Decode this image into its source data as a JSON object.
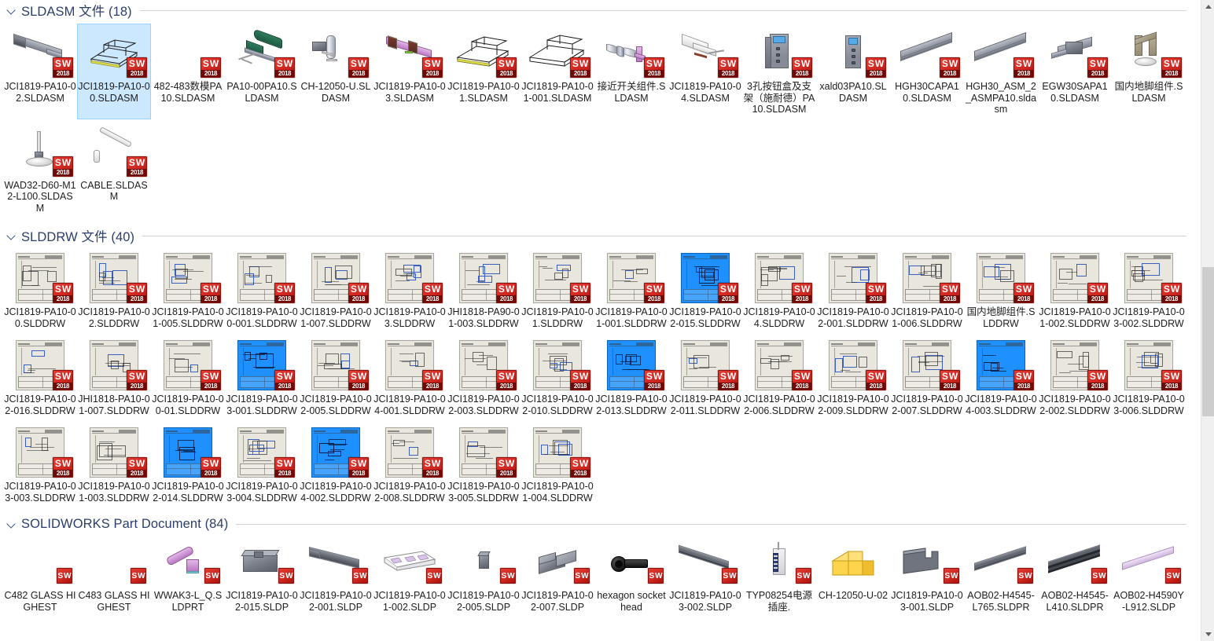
{
  "window": {
    "view_mode": "large-icons",
    "accent_selection": "#cce8ff",
    "group_header_color": "#2b3e6b"
  },
  "scrollbar": {
    "up_arrow": "▲",
    "down_arrow": "▼"
  },
  "groups": [
    {
      "id": "sldasm",
      "title": "SLDASM 文件 (18)",
      "items": [
        {
          "name": "JCI1819-PA10-02.SLDASM",
          "icon": "sw-assembly-conveyor",
          "selected": false
        },
        {
          "name": "JCI1819-PA10-00.SLDASM",
          "icon": "sw-assembly-frame-wire",
          "selected": true
        },
        {
          "name": "482-483数模PA10.SLDASM",
          "icon": "sw-badge-only",
          "selected": false
        },
        {
          "name": "PA10-00PA10.SLDASM",
          "icon": "sw-assembly-green-arm",
          "selected": false
        },
        {
          "name": "CH-12050-U.SLDASM",
          "icon": "sw-assembly-clamp",
          "selected": false
        },
        {
          "name": "JCI1819-PA10-03.SLDASM",
          "icon": "sw-assembly-purple-beam",
          "selected": false
        },
        {
          "name": "JCI1819-PA10-01.SLDASM",
          "icon": "sw-assembly-frame-wire",
          "selected": false
        },
        {
          "name": "JCI1819-PA10-01-001.SLDASM",
          "icon": "sw-assembly-frame-wire",
          "selected": false
        },
        {
          "name": "接近开关组件.SLDASM",
          "icon": "sw-assembly-sensor",
          "selected": false
        },
        {
          "name": "JCI1819-PA10-04.SLDASM",
          "icon": "sw-assembly-white-bracket",
          "selected": false
        },
        {
          "name": "3孔按钮盒及支架（施耐德）PA10.SLDASM",
          "icon": "sw-assembly-buttonbox",
          "selected": false
        },
        {
          "name": "xald03PA10.SLDASM",
          "icon": "sw-assembly-buttonbox-slim",
          "selected": false
        },
        {
          "name": "HGH30CAPA10.SLDASM",
          "icon": "sw-assembly-linear-rail",
          "selected": false
        },
        {
          "name": "HGH30_ASM_2_ASMPA10.sldasm",
          "icon": "sw-assembly-linear-rail",
          "selected": false
        },
        {
          "name": "EGW30SAPA10.SLDASM",
          "icon": "sw-assembly-rail-block",
          "selected": false
        },
        {
          "name": "国内地脚组件.SLDASM",
          "icon": "sw-assembly-footing",
          "selected": false
        },
        {
          "name": "WAD32-D60-M12-L100.SLDASM",
          "icon": "sw-assembly-leveling-foot",
          "selected": false
        },
        {
          "name": "CABLE.SLDASM",
          "icon": "sw-assembly-cable",
          "selected": false
        }
      ]
    },
    {
      "id": "slddrw",
      "title": "SLDDRW 文件 (40)",
      "items": [
        {
          "name": "JCI1819-PA10-00.SLDDRW",
          "icon": "sw-drawing",
          "variant": "beige"
        },
        {
          "name": "JCI1819-PA10-02.SLDDRW",
          "icon": "sw-drawing",
          "variant": "beige"
        },
        {
          "name": "JCI1819-PA10-01-005.SLDDRW",
          "icon": "sw-drawing",
          "variant": "beige"
        },
        {
          "name": "JCI1819-PA10-00-001.SLDDRW",
          "icon": "sw-drawing",
          "variant": "beige"
        },
        {
          "name": "JCI1819-PA10-01-007.SLDDRW",
          "icon": "sw-drawing",
          "variant": "beige"
        },
        {
          "name": "JCI1819-PA10-03.SLDDRW",
          "icon": "sw-drawing",
          "variant": "beige"
        },
        {
          "name": "JHI1818-PA90-01-003.SLDDRW",
          "icon": "sw-drawing",
          "variant": "beige"
        },
        {
          "name": "JCI1819-PA10-01.SLDDRW",
          "icon": "sw-drawing",
          "variant": "beige"
        },
        {
          "name": "JCI1819-PA10-01-001.SLDDRW",
          "icon": "sw-drawing",
          "variant": "beige"
        },
        {
          "name": "JCI1819-PA10-02-015.SLDDRW",
          "icon": "sw-drawing",
          "variant": "blue"
        },
        {
          "name": "JCI1819-PA10-04.SLDDRW",
          "icon": "sw-drawing",
          "variant": "beige"
        },
        {
          "name": "JCI1819-PA10-02-001.SLDDRW",
          "icon": "sw-drawing",
          "variant": "beige"
        },
        {
          "name": "JCI1819-PA10-01-006.SLDDRW",
          "icon": "sw-drawing",
          "variant": "beige"
        },
        {
          "name": "国内地脚组件.SLDDRW",
          "icon": "sw-drawing",
          "variant": "beige"
        },
        {
          "name": "JCI1819-PA10-01-002.SLDDRW",
          "icon": "sw-drawing",
          "variant": "beige"
        },
        {
          "name": "JCI1819-PA10-03-002.SLDDRW",
          "icon": "sw-drawing",
          "variant": "beige"
        },
        {
          "name": "JCI1819-PA10-02-016.SLDDRW",
          "icon": "sw-drawing",
          "variant": "beige"
        },
        {
          "name": "JHI1818-PA10-01-007.SLDDRW",
          "icon": "sw-drawing",
          "variant": "beige"
        },
        {
          "name": "JCI1819-PA10-00-01.SLDDRW",
          "icon": "sw-drawing",
          "variant": "beige"
        },
        {
          "name": "JCI1819-PA10-03-001.SLDDRW",
          "icon": "sw-drawing",
          "variant": "blue"
        },
        {
          "name": "JCI1819-PA10-02-005.SLDDRW",
          "icon": "sw-drawing",
          "variant": "beige"
        },
        {
          "name": "JCI1819-PA10-04-001.SLDDRW",
          "icon": "sw-drawing",
          "variant": "beige"
        },
        {
          "name": "JCI1819-PA10-02-003.SLDDRW",
          "icon": "sw-drawing",
          "variant": "beige"
        },
        {
          "name": "JCI1819-PA10-02-010.SLDDRW",
          "icon": "sw-drawing",
          "variant": "beige"
        },
        {
          "name": "JCI1819-PA10-02-013.SLDDRW",
          "icon": "sw-drawing",
          "variant": "blue"
        },
        {
          "name": "JCI1819-PA10-02-011.SLDDRW",
          "icon": "sw-drawing",
          "variant": "beige"
        },
        {
          "name": "JCI1819-PA10-02-006.SLDDRW",
          "icon": "sw-drawing",
          "variant": "beige"
        },
        {
          "name": "JCI1819-PA10-02-009.SLDDRW",
          "icon": "sw-drawing",
          "variant": "beige"
        },
        {
          "name": "JCI1819-PA10-02-007.SLDDRW",
          "icon": "sw-drawing",
          "variant": "beige"
        },
        {
          "name": "JCI1819-PA10-04-003.SLDDRW",
          "icon": "sw-drawing",
          "variant": "blue"
        },
        {
          "name": "JCI1819-PA10-02-002.SLDDRW",
          "icon": "sw-drawing",
          "variant": "beige"
        },
        {
          "name": "JCI1819-PA10-03-006.SLDDRW",
          "icon": "sw-drawing",
          "variant": "beige"
        },
        {
          "name": "JCI1819-PA10-03-003.SLDDRW",
          "icon": "sw-drawing",
          "variant": "beige"
        },
        {
          "name": "JCI1819-PA10-01-003.SLDDRW",
          "icon": "sw-drawing",
          "variant": "beige"
        },
        {
          "name": "JCI1819-PA10-02-014.SLDDRW",
          "icon": "sw-drawing",
          "variant": "blue"
        },
        {
          "name": "JCI1819-PA10-03-004.SLDDRW",
          "icon": "sw-drawing",
          "variant": "beige"
        },
        {
          "name": "JCI1819-PA10-04-002.SLDDRW",
          "icon": "sw-drawing",
          "variant": "blue"
        },
        {
          "name": "JCI1819-PA10-02-008.SLDDRW",
          "icon": "sw-drawing",
          "variant": "beige"
        },
        {
          "name": "JCI1819-PA10-03-005.SLDDRW",
          "icon": "sw-drawing",
          "variant": "beige"
        },
        {
          "name": "JCI1819-PA10-01-004.SLDDRW",
          "icon": "sw-drawing",
          "variant": "beige"
        }
      ]
    },
    {
      "id": "sldprt",
      "title": "SOLIDWORKS Part Document (84)",
      "items": [
        {
          "name": "C482 GLASS HIGHEST",
          "icon": "sw-part-badge-only"
        },
        {
          "name": "C483 GLASS HIGHEST",
          "icon": "sw-part-badge-only"
        },
        {
          "name": "WWAK3-L_Q.SLDPRT",
          "icon": "sw-part-pink-fitting"
        },
        {
          "name": "JCI1819-PA10-02-015.SLDP",
          "icon": "sw-part-dark-block"
        },
        {
          "name": "JCI1819-PA10-02-001.SLDP",
          "icon": "sw-part-long-plate"
        },
        {
          "name": "JCI1819-PA10-01-002.SLDP",
          "icon": "sw-part-hollow-beam"
        },
        {
          "name": "JCI1819-PA10-02-005.SLDP",
          "icon": "sw-part-small-block"
        },
        {
          "name": "JCI1819-PA10-02-007.SLDP",
          "icon": "sw-part-tee-block"
        },
        {
          "name": "hexagon socket head",
          "icon": "sw-part-hex-bolt"
        },
        {
          "name": "JCI1819-PA10-03-002.SLDP",
          "icon": "sw-part-angle-bar"
        },
        {
          "name": "TYP08254电源插座.",
          "icon": "sw-part-socket"
        },
        {
          "name": "CH-12050-U-02",
          "icon": "sw-part-default-yellow"
        },
        {
          "name": "JCI1819-PA10-03-001.SLDP",
          "icon": "sw-part-bracket"
        },
        {
          "name": "AOB02-H4545-L765.SLDPR",
          "icon": "sw-part-extrusion"
        },
        {
          "name": "AOB02-H4545-L410.SLDPR",
          "icon": "sw-part-extrusion-dark"
        },
        {
          "name": "AOB02-H4590Y-L912.SLDP",
          "icon": "sw-part-extrusion-light"
        }
      ]
    }
  ]
}
